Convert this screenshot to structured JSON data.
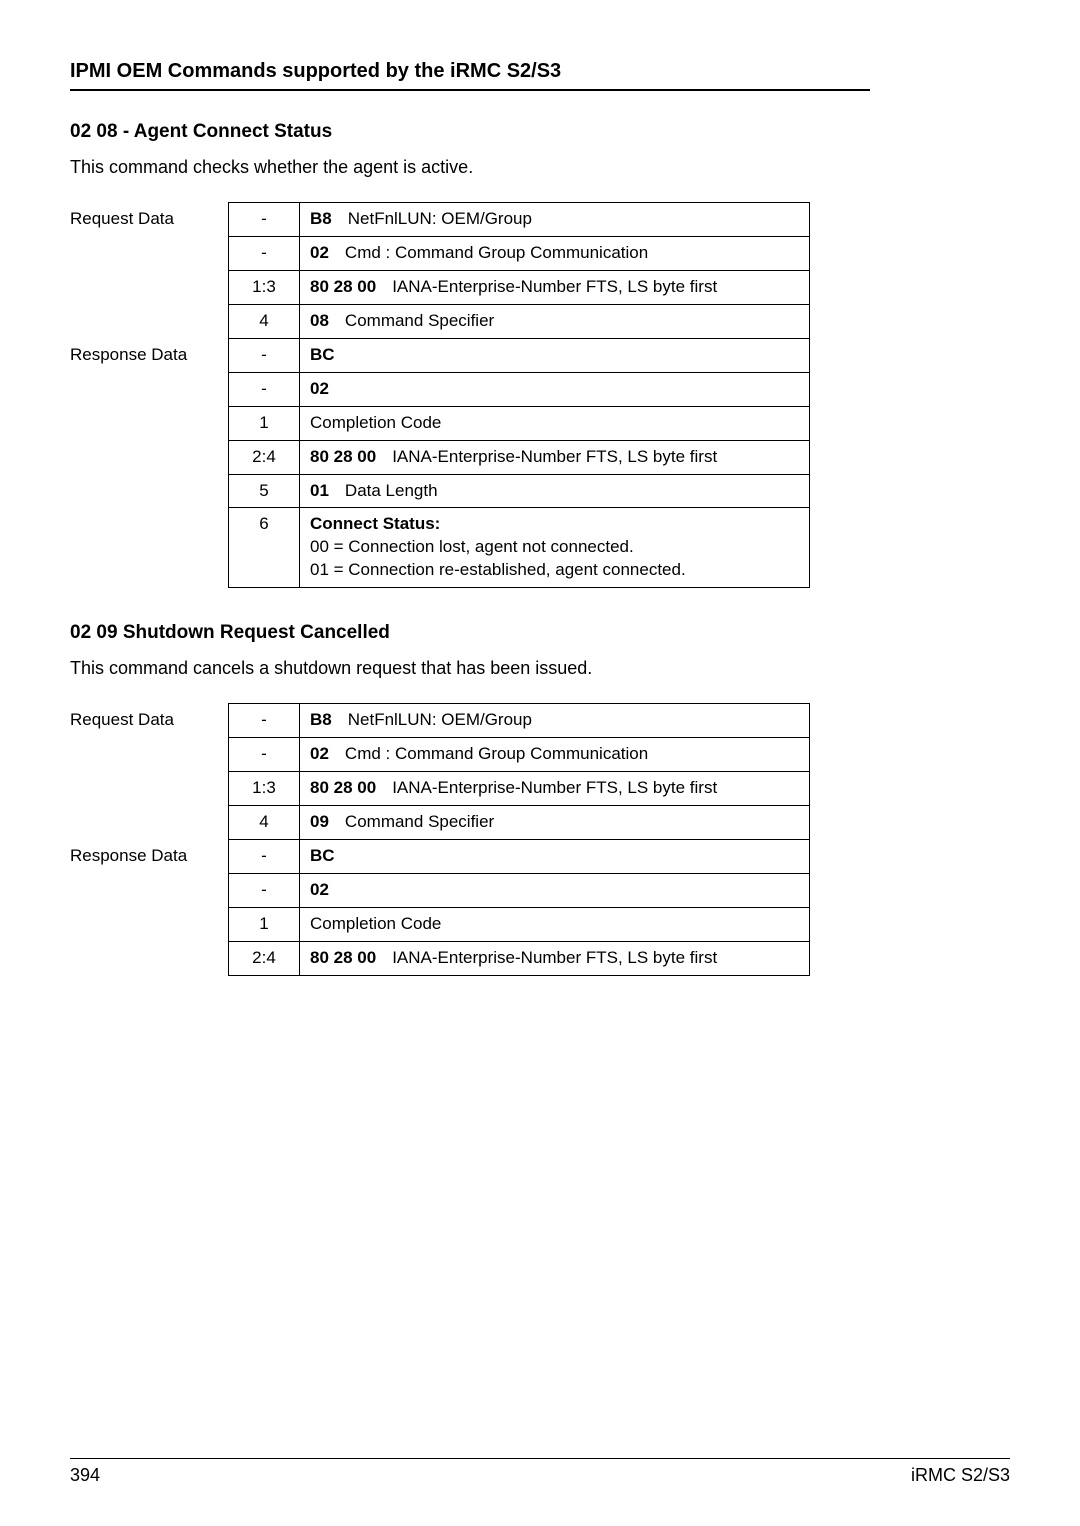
{
  "header": {
    "title": "IPMI OEM Commands supported by the iRMC S2/S3"
  },
  "sections": [
    {
      "heading": "02 08 - Agent Connect Status",
      "description": "This command checks whether the agent is active.",
      "labels": {
        "request": "Request Data",
        "response": "Response Data"
      },
      "rows": [
        {
          "type": "req",
          "byte": "-",
          "html": "<span class='bold'>B8</span><span class='code-text'>NetFnlLUN:  OEM/Group</span>"
        },
        {
          "type": "req",
          "byte": "-",
          "html": "<span class='bold'>02</span><span class='code-text'>Cmd  : Command Group Communication</span>"
        },
        {
          "type": "req",
          "byte": "1:3",
          "html": "<span class='bold'>80 28 00</span><span class='code-text'>IANA-Enterprise-Number FTS, LS byte first</span>"
        },
        {
          "type": "req",
          "byte": "4",
          "html": "<span class='bold'>08</span><span class='code-text'>Command Specifier</span>"
        },
        {
          "type": "res",
          "byte": "-",
          "html": "<span class='bold'>BC</span>"
        },
        {
          "type": "res",
          "byte": "-",
          "html": "<span class='bold'>02</span>"
        },
        {
          "type": "res",
          "byte": "1",
          "html": "Completion Code"
        },
        {
          "type": "res",
          "byte": "2:4",
          "html": "<span class='bold'>80 28 00</span><span class='code-text'>IANA-Enterprise-Number FTS, LS byte first</span>"
        },
        {
          "type": "res",
          "byte": "5",
          "html": "<span class='bold'>01</span><span class='code-text'>Data Length</span>"
        },
        {
          "type": "res",
          "byte": "6",
          "html": "<span class='bold'>Connect Status:</span><br><span class='sub-line'>00  =  Connection lost, agent not connected.</span><br><span class='sub-line'>01  =  Connection re-established, agent connected.</span>"
        }
      ],
      "response_start": 4
    },
    {
      "heading": "02 09   Shutdown Request Cancelled",
      "description": "This command cancels a shutdown request that has been issued.",
      "labels": {
        "request": "Request Data",
        "response": "Response Data"
      },
      "rows": [
        {
          "type": "req",
          "byte": "-",
          "html": "<span class='bold'>B8</span><span class='code-text'>NetFnlLUN:  OEM/Group</span>"
        },
        {
          "type": "req",
          "byte": "-",
          "html": "<span class='bold'>02</span><span class='code-text'>Cmd  : Command Group Communication</span>"
        },
        {
          "type": "req",
          "byte": "1:3",
          "html": "<span class='bold'>80 28 00</span><span class='code-text'>IANA-Enterprise-Number FTS, LS byte first</span>"
        },
        {
          "type": "req",
          "byte": "4",
          "html": "<span class='bold'>09</span><span class='code-text'>Command Specifier</span>"
        },
        {
          "type": "res",
          "byte": "-",
          "html": "<span class='bold'>BC</span>"
        },
        {
          "type": "res",
          "byte": "-",
          "html": "<span class='bold'>02</span>"
        },
        {
          "type": "res",
          "byte": "1",
          "html": "Completion Code"
        },
        {
          "type": "res",
          "byte": "2:4",
          "html": "<span class='bold'>80 28 00</span><span class='code-text'>IANA-Enterprise-Number FTS, LS byte first</span>"
        }
      ],
      "response_start": 4
    }
  ],
  "footer": {
    "page": "394",
    "doc": "iRMC S2/S3"
  }
}
